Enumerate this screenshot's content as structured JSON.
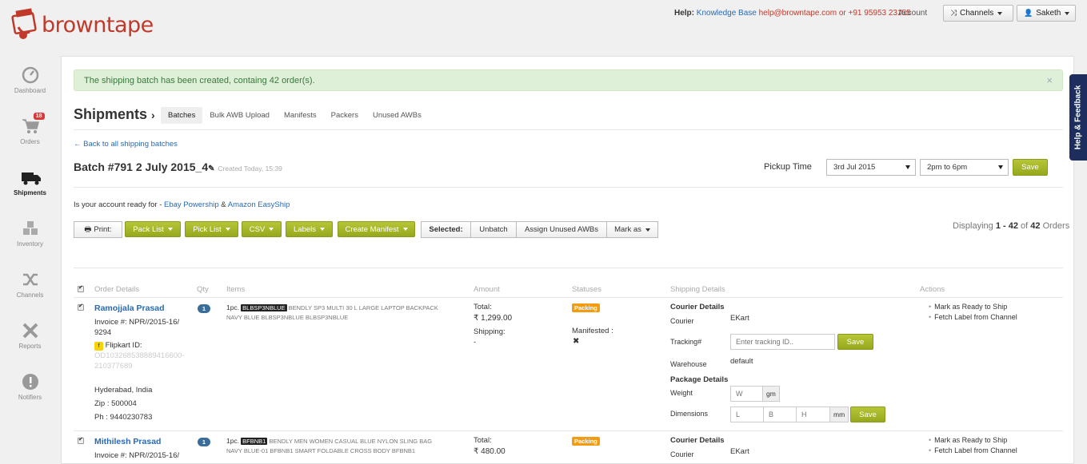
{
  "brand": {
    "name": "browntape"
  },
  "topbar": {
    "help_label": "Help:",
    "knowledge_base": "Knowledge Base",
    "email": "help@browntape.com",
    "or_text": "or",
    "phone": "+91 95953 23155",
    "account": "Account",
    "channels_label": "Channels",
    "user_label": "Saketh"
  },
  "sidebar": {
    "items": [
      {
        "label": "Dashboard",
        "icon": "dashboard-icon"
      },
      {
        "label": "Orders",
        "icon": "cart-icon",
        "badge": "18"
      },
      {
        "label": "Shipments",
        "icon": "truck-icon",
        "active": true
      },
      {
        "label": "Inventory",
        "icon": "boxes-icon"
      },
      {
        "label": "Channels",
        "icon": "shuffle-icon"
      },
      {
        "label": "Reports",
        "icon": "reports-icon"
      },
      {
        "label": "Notifiers",
        "icon": "alert-icon"
      }
    ]
  },
  "alert": {
    "message": "The shipping batch has been created, containg 42 order(s).",
    "close": "×"
  },
  "page": {
    "title": "Shipments",
    "tabs": [
      "Batches",
      "Bulk AWB Upload",
      "Manifests",
      "Packers",
      "Unused AWBs"
    ],
    "back_link": "← Back to all shipping batches",
    "batch_title": "Batch #791  2 July 2015_4",
    "batch_created": "Created Today, 15:39"
  },
  "pickup": {
    "label": "Pickup Time",
    "date": "3rd Jul 2015",
    "slot": "2pm to 6pm",
    "save": "Save"
  },
  "ready": {
    "prefix": "Is your account ready for -",
    "link1": "Ebay Powership",
    "amp": "&",
    "link2": "Amazon EasyShip"
  },
  "toolbar": {
    "print": "Print:",
    "pack_list": "Pack List",
    "pick_list": "Pick List",
    "csv": "CSV",
    "labels": "Labels",
    "create_manifest": "Create Manifest",
    "selected": "Selected:",
    "unbatch": "Unbatch",
    "assign_awbs": "Assign Unused AWBs",
    "mark_as": "Mark as"
  },
  "displaying": {
    "prefix": "Displaying",
    "range": "1 - 42",
    "of": "of",
    "total": "42",
    "suffix": "Orders"
  },
  "table": {
    "headers": [
      "Order Details",
      "Qty",
      "Items",
      "Amount",
      "Statuses",
      "Shipping Details",
      "Actions"
    ],
    "rows": [
      {
        "name": "Ramojjala Prasad",
        "invoice": "Invoice #: NPR//2015-16/",
        "invoice2": "9294",
        "channel_label": "Flipkart ID:",
        "channel_id": "OD103268538889416600-",
        "channel_id2": "210377689",
        "city": "Hyderabad, India",
        "zip": "Zip : 500004",
        "phone": "Ph : 9440230783",
        "qty": "1",
        "item_qty": "1pc.",
        "sku": "BLBSP3NBLUE",
        "item_desc": "BENDLY SP3 MULTI 30 L LARGE LAPTOP BACKPACK",
        "item_desc2": "NAVY BLUE BLBSP3NBLUE BLBSP3NBLUE",
        "total_label": "Total:",
        "total": "₹ 1,299.00",
        "shipping_label": "Shipping:",
        "shipping": "-",
        "status": "Packing",
        "manifested_label": "Manifested :",
        "manifested_mark": "✖",
        "courier_details": "Courier Details",
        "courier_label": "Courier",
        "courier": "EKart",
        "tracking_label": "Tracking#",
        "tracking_placeholder": "Enter tracking ID..",
        "save": "Save",
        "warehouse_label": "Warehouse",
        "warehouse": "default",
        "package_details": "Package Details",
        "weight_label": "Weight",
        "weight_placeholder": "W",
        "weight_unit": "gm",
        "dimensions_label": "Dimensions",
        "l": "L",
        "b": "B",
        "h": "H",
        "dim_unit": "mm",
        "action1": "Mark as Ready to Ship",
        "action2": "Fetch Label from Channel"
      },
      {
        "name": "Mithilesh Prasad",
        "invoice": "Invoice #: NPR//2015-16/",
        "qty": "1",
        "item_qty": "1pc.",
        "sku": "BFBNB1",
        "item_desc": "BENDLY MEN WOMEN CASUAL BLUE NYLON SLING BAG",
        "item_desc2": "NAVY BLUE-01 BFBNB1 SMART FOLDABLE CROSS BODY BFBNB1",
        "total_label": "Total:",
        "total": "₹ 480.00",
        "status": "Packing",
        "courier_details": "Courier Details",
        "courier_label": "Courier",
        "courier": "EKart",
        "action1": "Mark as Ready to Ship",
        "action2": "Fetch Label from Channel"
      }
    ]
  },
  "feedback_tab": "Help & Feedback",
  "colors": {
    "brand_red": "#c0392b",
    "accent_green": "#a2b32a",
    "link_blue": "#2a6ab3",
    "status_orange": "#f39c12"
  }
}
